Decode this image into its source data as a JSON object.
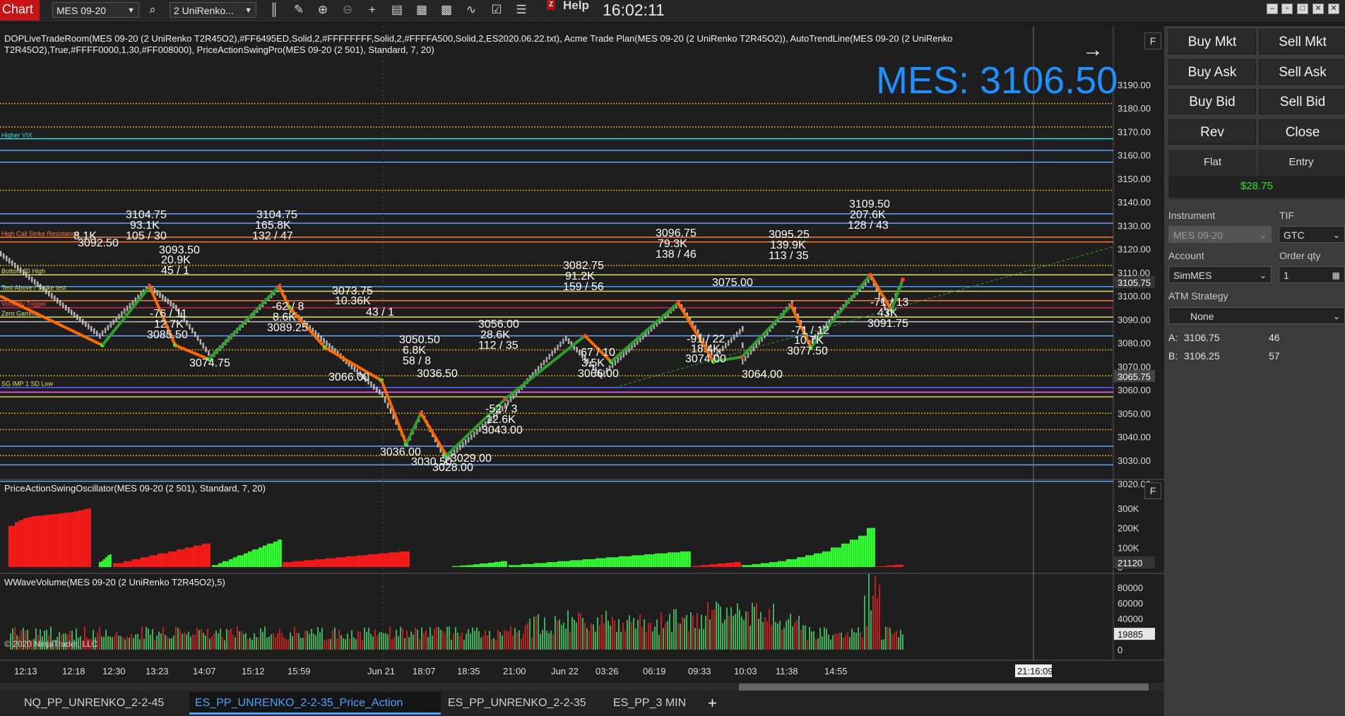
{
  "toolbar": {
    "chart_label": "Chart",
    "instrument": "MES 09-20",
    "bar_type": "2 UniRenko...",
    "help_mark": "Z",
    "help_label": "Help",
    "clock": "16:02:11",
    "icons": [
      "search-icon",
      "bars-icon",
      "pencil-icon",
      "zoom-in-icon",
      "zoom-out-icon",
      "crosshair-icon",
      "properties-icon",
      "strategy-icon",
      "indicator-icon",
      "template-icon",
      "list-icon"
    ]
  },
  "chart": {
    "title_line1": "DOPLiveTradeRoom(MES 09-20 (2 UniRenko T2R45O2),#FF6495ED,Solid,2,#FFFFFFFF,Solid,2,#FFFFA500,Solid,2,ES2020.06.22.txt), Acme Trade Plan(MES 09-20 (2 UniRenko T2R45O2)), AutoTrendLine(MES 09-20 (2 UniRenko",
    "title_line2": "T2R45O2),True,#FFFF0000,1,30,#FF008000), PriceActionSwingPro(MES 09-20 (2 501), Standard, 7, 20)",
    "big_price": "MES: 3106.50",
    "price_axis_labels": [
      "3190.00",
      "3180.00",
      "3170.00",
      "3160.00",
      "3150.00",
      "3140.00",
      "3130.00",
      "3120.00",
      "3110.00",
      "3100.00",
      "3090.00",
      "3080.00",
      "3070.00",
      "3060.00",
      "3050.00",
      "3040.00",
      "3030.00",
      "3020.00"
    ],
    "current_price_tag": "3105.75",
    "lower_price_tag": "3065.75",
    "level_labels": [
      "Higher VIX",
      "High Call Strike Resistance",
      "Bottom 20 High",
      "Test Above / Strike test",
      "Volatility Trigger",
      "Zero Gamma",
      "SG IMP 1 SD Low"
    ],
    "swing_labels": [
      {
        "t": "3104.75"
      },
      {
        "t": "93.1K"
      },
      {
        "t": "105 / 30"
      },
      {
        "t": "3104.75"
      },
      {
        "t": "165.8K"
      },
      {
        "t": "132 / 47"
      },
      {
        "t": "3093.50"
      },
      {
        "t": "20.9K"
      },
      {
        "t": "45 / 1"
      },
      {
        "t": "3092.50"
      },
      {
        "t": "8.1K"
      },
      {
        "t": "-76 / 11"
      },
      {
        "t": "12.7K"
      },
      {
        "t": "3085.50"
      },
      {
        "t": "-62 / 8"
      },
      {
        "t": "8.6K"
      },
      {
        "t": "3089.25"
      },
      {
        "t": "3073.75"
      },
      {
        "t": "10.36K"
      },
      {
        "t": "43 / 1"
      },
      {
        "t": "3050.50"
      },
      {
        "t": "6.8K"
      },
      {
        "t": "58 / 8"
      },
      {
        "t": "3036.50"
      },
      {
        "t": "3056.00"
      },
      {
        "t": "28.6K"
      },
      {
        "t": "112 / 35"
      },
      {
        "t": "-52 / 3"
      },
      {
        "t": "12.6K"
      },
      {
        "t": "3043.00"
      },
      {
        "t": "3082.75"
      },
      {
        "t": "91.2K"
      },
      {
        "t": "159 / 56"
      },
      {
        "t": "67 / 10"
      },
      {
        "t": "3.5K"
      },
      {
        "t": "3066.00"
      },
      {
        "t": "3096.75"
      },
      {
        "t": "79.3K"
      },
      {
        "t": "138 / 46"
      },
      {
        "t": "3075.00"
      },
      {
        "t": "-91 / 22"
      },
      {
        "t": "18.4K"
      },
      {
        "t": "3074.00"
      },
      {
        "t": "3064.00"
      },
      {
        "t": "3095.25"
      },
      {
        "t": "139.9K"
      },
      {
        "t": "113 / 35"
      },
      {
        "t": "-71 / 12"
      },
      {
        "t": "10.7K"
      },
      {
        "t": "3077.50"
      },
      {
        "t": "3109.50"
      },
      {
        "t": "207.6K"
      },
      {
        "t": "128 / 43"
      },
      {
        "t": "-71 / 13"
      },
      {
        "t": "43K"
      },
      {
        "t": "3091.75"
      },
      {
        "t": "3074.75"
      },
      {
        "t": "3028.00"
      },
      {
        "t": "3036.00"
      },
      {
        "t": "3066.00"
      },
      {
        "t": "3030.50"
      },
      {
        "t": "3029.00"
      }
    ],
    "osc_title": "PriceActionSwingOscillator(MES 09-20 (2 501), Standard, 7, 20)",
    "osc_axis": [
      "300K",
      "200K",
      "100K",
      "0"
    ],
    "osc_tag": "21120",
    "vol_title": "WWaveVolume(MES 09-20 (2 UniRenko T2R45O2),5)",
    "vol_axis": [
      "80000",
      "60000",
      "40000",
      "20000",
      "0"
    ],
    "vol_tag": "19885",
    "copyright": "© 2020 NinjaTrader, LLC",
    "time_labels": [
      "12:13",
      "12:18",
      "12:30",
      "13:23",
      "14:07",
      "15:12",
      "15:59",
      "Jun 21",
      "18:07",
      "18:35",
      "21:00",
      "Jun 22",
      "03:26",
      "06:19",
      "09:33",
      "10:03",
      "11:38",
      "14:55"
    ],
    "time_cursor": "21:16:09",
    "f_label": "F",
    "arrow": "→"
  },
  "panel": {
    "buttons": [
      "Buy Mkt",
      "Sell Mkt",
      "Buy Ask",
      "Sell Ask",
      "Buy Bid",
      "Sell Bid",
      "Rev",
      "Close"
    ],
    "position_label": "Flat",
    "entry_label": "Entry",
    "pnl": "$28.75",
    "instrument_label": "Instrument",
    "instrument_value": "MES 09-20",
    "tif_label": "TIF",
    "tif_value": "GTC",
    "account_label": "Account",
    "account_value": "SimMES",
    "qty_label": "Order qty",
    "qty_value": "1",
    "atm_label": "ATM Strategy",
    "atm_value": "None",
    "ask_label": "A:",
    "ask_price": "3106.75",
    "ask_size": "46",
    "bid_label": "B:",
    "bid_price": "3106.25",
    "bid_size": "57"
  },
  "tabs": {
    "items": [
      "NQ_PP_UNRENKO_2-2-45",
      "ES_PP_UNRENKO_2-2-35_Price_Action",
      "ES_PP_UNRENKO_2-2-35",
      "ES_PP_3 MIN"
    ],
    "active_index": 1,
    "add": "+"
  },
  "colors": {
    "up": "#32ff32",
    "down": "#ff1a1a",
    "accent": "#1e90ff",
    "swing_up": "#2e9e2e",
    "swing_down": "#ff6a00"
  }
}
